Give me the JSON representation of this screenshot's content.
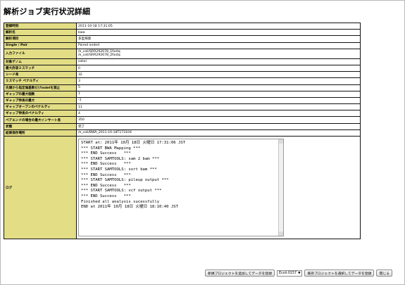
{
  "page": {
    "title": "解析ジョブ実行状況詳細"
  },
  "details": [
    {
      "label": "登録時刻",
      "value": "2011-10-18 17:31:05"
    },
    {
      "label": "解析名",
      "value": "bwa"
    },
    {
      "label": "解析項目",
      "value": "多型探索"
    },
    {
      "label": "Single / Pair",
      "value": "Paired ended"
    },
    {
      "label": "入力ファイル",
      "value": "/e_coli/SRR292678_1fastq",
      "value2": "/e_coli/SRR292678_2fastq"
    },
    {
      "label": "対象ゲノム",
      "value": "sakai"
    },
    {
      "label": "最大許容ミスマッチ",
      "value": "0"
    },
    {
      "label": "シード長",
      "value": "32"
    },
    {
      "label": "ミスマッチ ペナルティ",
      "value": "3"
    },
    {
      "label": "先頭から指定塩基数だけindelを禁止",
      "value": "5"
    },
    {
      "label": "ギャップの最大個数",
      "value": "1"
    },
    {
      "label": "ギャップ伸長の最大",
      "value": "-1"
    },
    {
      "label": "ギャップオープンのペナルティ",
      "value": "11"
    },
    {
      "label": "ギャップ伸長のペナルティ",
      "value": "4"
    },
    {
      "label": "ペアエンドの場合の最大インサート長",
      "value": "350"
    },
    {
      "label": "状態",
      "value": "完了"
    },
    {
      "label": "結果保存場所",
      "value": "/e_coli/BWA_2011-10-18T173104"
    }
  ],
  "log": {
    "label": "ログ",
    "text": "START at: 2011年 10月 18日 火曜日 17:31:06 JST\n*** START BWA Mapping ***\n*** END Success   ***\n*** START SAMTOOLS: sam 2 bam ***\n*** END Success   ***\n*** START SAMTOOLS: sort bam ***\n*** END Success   ***\n*** START SAMTOOLS: pileup output ***\n*** END Success   ***\n*** START SAMTOOLS: vcf output ***\n*** END Success   ***\nFinished all analysis sucessfully\nEND at 2011年 10月 18日 火曜日 18:10:40 JST"
  },
  "footer": {
    "add_new_button": "新規プロジェクトを追加してデータを登録",
    "project_select": "Ecoli:0157",
    "add_existing_button": "既存プロジェクトを選択してデータを登録",
    "close_button": "閉じる"
  },
  "colors": {
    "label_bg": "#e3de86",
    "border": "#111111"
  }
}
